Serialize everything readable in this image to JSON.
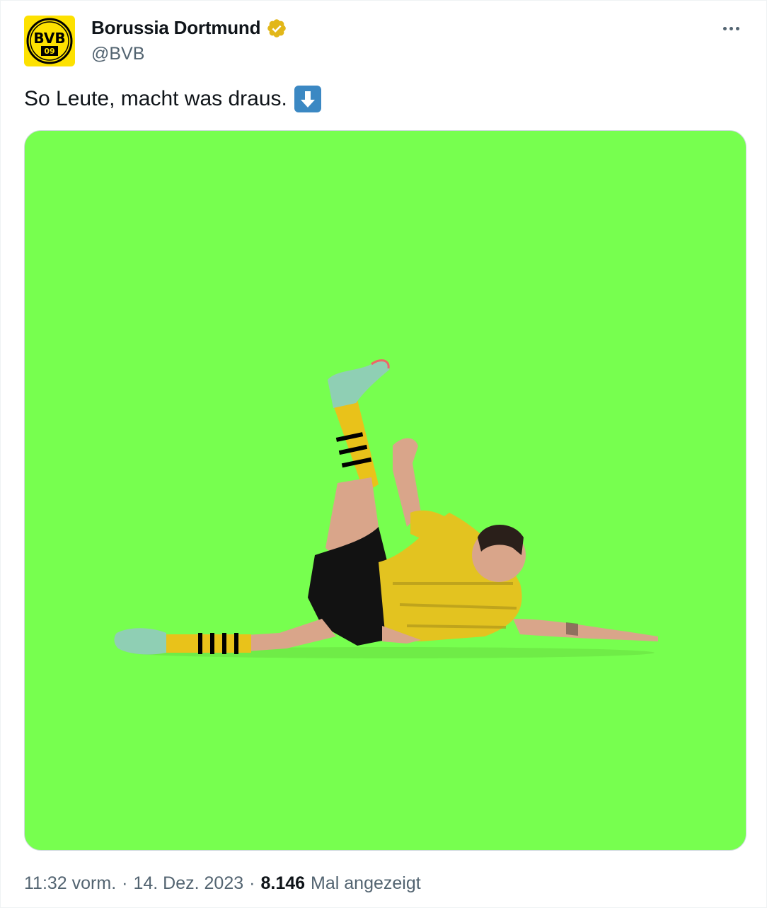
{
  "author": {
    "name": "Borussia Dortmund",
    "handle": "@BVB",
    "avatar_text": "BVB",
    "avatar_sub": "09",
    "verified_color": "#e2b719"
  },
  "tweet": {
    "text": "So Leute, macht was draus.",
    "emoji": "arrow-down-emoji"
  },
  "media": {
    "background_color": "#77ff4f",
    "subject": "player-cutout-icon"
  },
  "meta": {
    "time": "11:32 vorm.",
    "separator": "·",
    "date": "14. Dez. 2023",
    "views_count": "8.146",
    "views_label": "Mal angezeigt"
  },
  "colors": {
    "text": "#0f1419",
    "secondary": "#536471",
    "bvb_yellow": "#fde100"
  }
}
